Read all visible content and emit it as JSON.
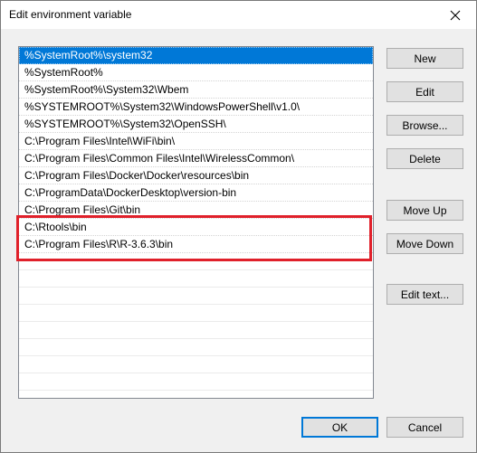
{
  "window": {
    "title": "Edit environment variable",
    "close_glyph": "✕"
  },
  "list": {
    "items": [
      "%SystemRoot%\\system32",
      "%SystemRoot%",
      "%SystemRoot%\\System32\\Wbem",
      "%SYSTEMROOT%\\System32\\WindowsPowerShell\\v1.0\\",
      "%SYSTEMROOT%\\System32\\OpenSSH\\",
      "C:\\Program Files\\Intel\\WiFi\\bin\\",
      "C:\\Program Files\\Common Files\\Intel\\WirelessCommon\\",
      "C:\\Program Files\\Docker\\Docker\\resources\\bin",
      "C:\\ProgramData\\DockerDesktop\\version-bin",
      "C:\\Program Files\\Git\\bin",
      "C:\\Rtools\\bin",
      "C:\\Program Files\\R\\R-3.6.3\\bin"
    ],
    "selected_index": 0,
    "highlighted_items": [
      "C:\\Rtools\\bin",
      "C:\\Program Files\\R\\R-3.6.3\\bin"
    ],
    "highlight_color": "#e0202a",
    "selection_color": "#0078d7"
  },
  "buttons": {
    "new": "New",
    "edit": "Edit",
    "browse": "Browse...",
    "delete": "Delete",
    "move_up": "Move Up",
    "move_down": "Move Down",
    "edit_text": "Edit text...",
    "ok": "OK",
    "cancel": "Cancel"
  }
}
